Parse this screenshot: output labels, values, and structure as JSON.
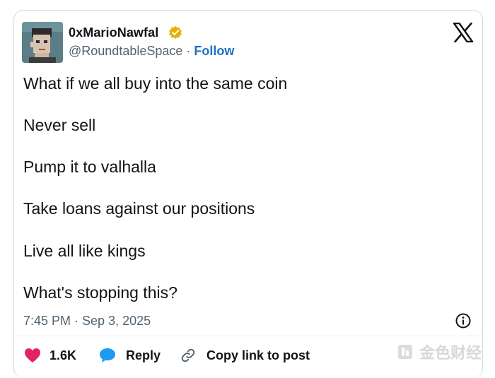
{
  "author": {
    "display_name": "0xMarioNawfal",
    "handle": "@RoundtableSpace",
    "separator": "·",
    "follow_label": "Follow",
    "verified_color": "#e6b00a"
  },
  "post": {
    "lines": [
      "What if we all buy into the same coin",
      "Never sell",
      "Pump it to valhalla",
      "Take loans against our positions",
      "Live all like kings",
      "What's stopping this?"
    ],
    "timestamp": "7:45 PM · Sep 3, 2025"
  },
  "actions": {
    "like_count": "1.6K",
    "reply_label": "Reply",
    "copy_label": "Copy link to post"
  },
  "icons": {
    "like": "heart-icon",
    "reply": "speech-bubble-icon",
    "copy": "link-icon",
    "info": "info-icon",
    "brand": "x-logo-icon",
    "verified": "verified-badge-icon"
  },
  "colors": {
    "like": "#e4245f",
    "reply": "#1d9bf0",
    "follow": "#1d6fc4",
    "muted": "#536471"
  },
  "watermark": {
    "text": "金色财经"
  }
}
